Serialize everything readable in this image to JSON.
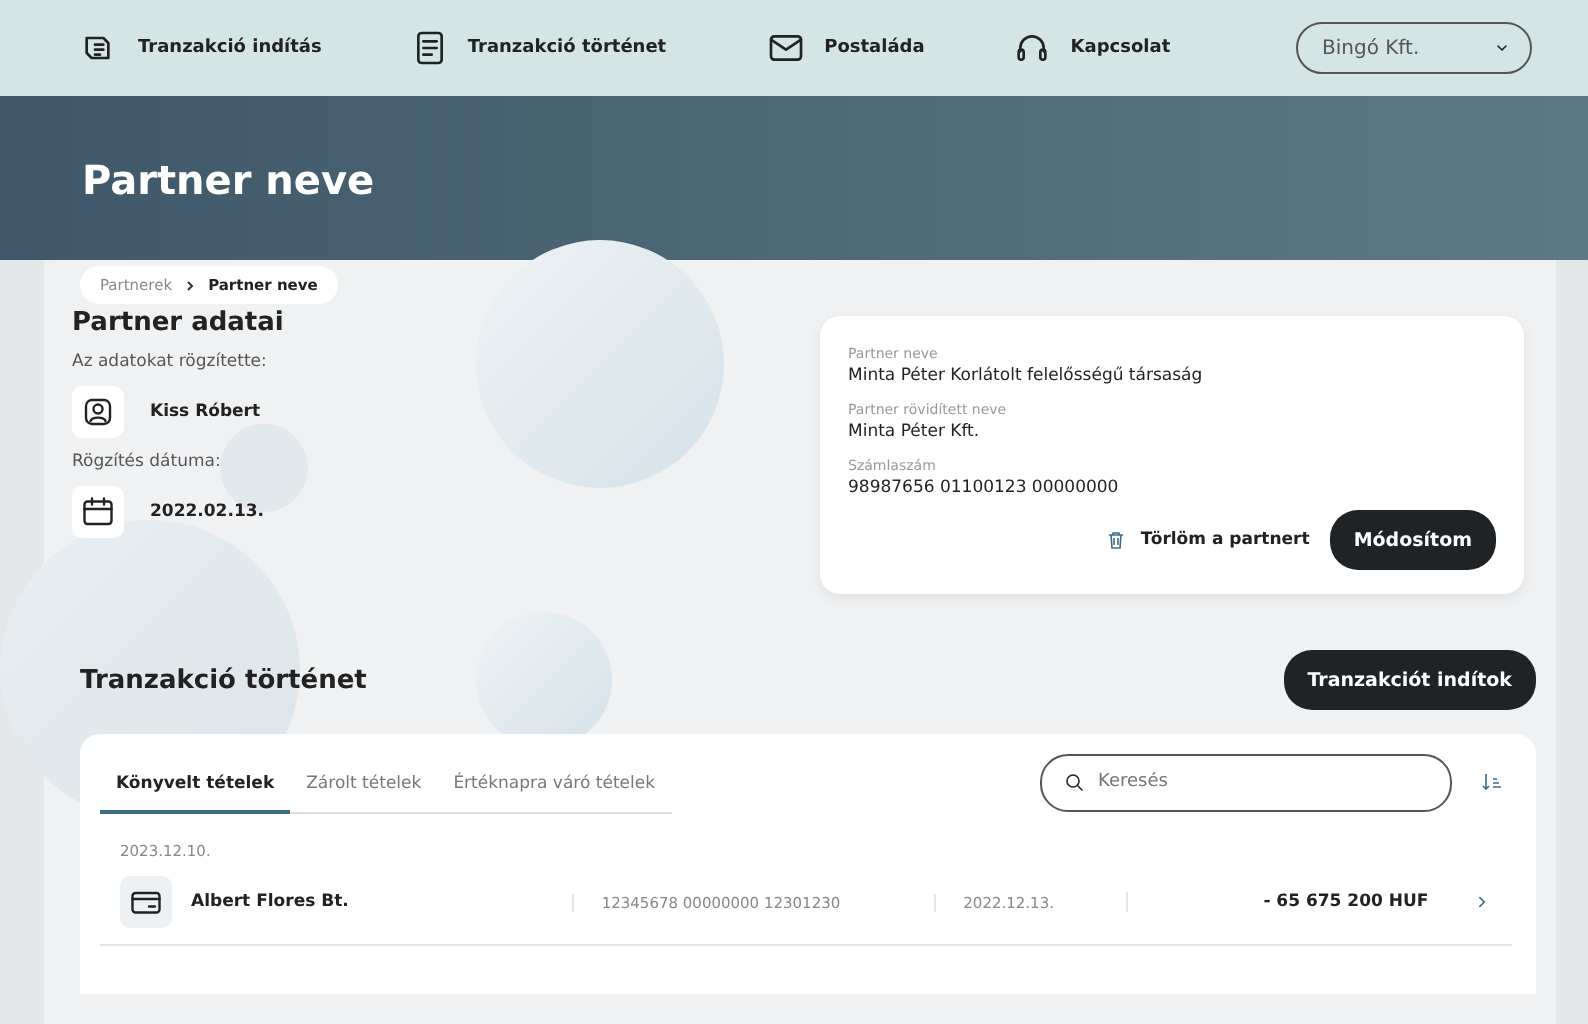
{
  "nav": {
    "items": [
      {
        "label": "Tranzakció indítás",
        "kind": "transfer"
      },
      {
        "label": "Tranzakció történet",
        "kind": "document"
      },
      {
        "label": "Postaláda",
        "kind": "mail"
      },
      {
        "label": "Kapcsolat",
        "kind": "headset"
      }
    ],
    "company_select": {
      "value": "Bingó Kft."
    }
  },
  "page_title": "Partner neve",
  "breadcrumb": [
    {
      "label": "Partnerek",
      "current": false
    },
    {
      "label": "Partner neve",
      "current": true
    }
  ],
  "partner_info": {
    "title": "Partner adatai",
    "fields": [
      {
        "label": "Az adatokat rögzítette:",
        "value": "Kiss Róbert",
        "kind": "person"
      },
      {
        "label": "Rögzítés dátuma:",
        "value": "2022.02.13.",
        "kind": "calendar"
      }
    ]
  },
  "partner_card": {
    "fields": [
      {
        "label": "Partner neve",
        "value": "Minta Péter Korlátolt felelősségű társaság"
      },
      {
        "label": "Partner rövidített neve",
        "value": "Minta Péter Kft."
      },
      {
        "label": "Számlaszám",
        "value": "98987656 01100123 00000000"
      }
    ],
    "delete_button": "Törlöm a partnert",
    "edit_button": "Módosítom"
  },
  "transactions": {
    "title": "Tranzakció történet",
    "start_button": "Tranzakciót indítok",
    "tabs": [
      {
        "label": "Könyvelt tételek",
        "selected": true
      },
      {
        "label": "Zárolt tételek",
        "selected": false
      },
      {
        "label": "Értéknapra váró tételek",
        "selected": false
      }
    ],
    "search": {
      "placeholder": "Keresés"
    },
    "groups": [
      {
        "date": "2023.12.10.",
        "rows": [
          {
            "name": "Albert Flores Bt.",
            "account": "12345678 00000000 12301230",
            "date": "2022.12.13.",
            "amount": "- 65 675 200 HUF"
          }
        ]
      }
    ]
  }
}
